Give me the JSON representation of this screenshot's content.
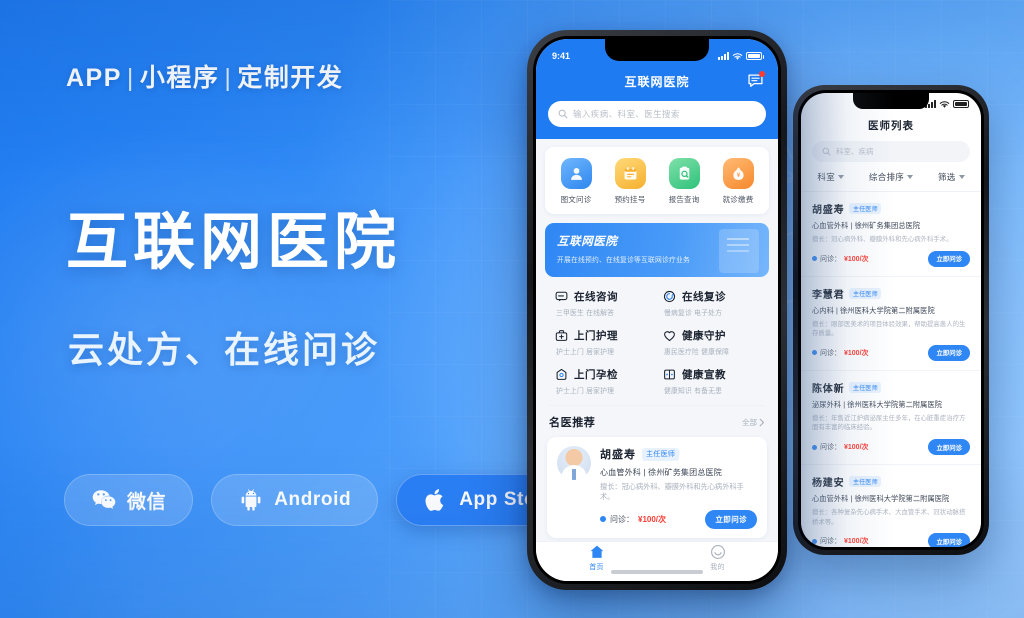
{
  "hero": {
    "kicker_parts": [
      "APP",
      "小程序",
      "定制开发"
    ],
    "kicker_separator": "|",
    "headline": "互联网医院",
    "subhead": "云处方、在线问诊"
  },
  "store_buttons": [
    {
      "label": "微信",
      "icon": "wechat-icon",
      "style": "ghost"
    },
    {
      "label": "Android",
      "icon": "android-icon",
      "style": "ghost"
    },
    {
      "label": "App Store",
      "icon": "apple-icon",
      "style": "solid"
    }
  ],
  "colors": {
    "brand_blue": "#2f86f5",
    "deep_blue": "#1f7bf2",
    "price_red": "#ff3a30",
    "tag_blue_bg": "#e8f2ff",
    "muted_text": "#a9b1bd"
  },
  "phone_front": {
    "status": {
      "time": "9:41",
      "signal_icon": "signal-bars-icon",
      "wifi_icon": "wifi-icon",
      "battery_icon": "battery-icon"
    },
    "nav": {
      "title": "互联网医院",
      "message_icon": "message-icon",
      "badge": ""
    },
    "search": {
      "placeholder": "输入疾病、科室、医生搜索",
      "icon": "search-icon"
    },
    "quick_actions": [
      {
        "label": "图文问诊",
        "icon": "doctor-avatar-icon",
        "color": "#2f86ee"
      },
      {
        "label": "预约挂号",
        "icon": "calendar-icon",
        "color": "#f5b02e"
      },
      {
        "label": "报告查询",
        "icon": "report-search-icon",
        "color": "#2ec27a"
      },
      {
        "label": "就诊缴费",
        "icon": "wallet-icon",
        "color": "#f6882c"
      }
    ],
    "banner": {
      "title": "互联网医院",
      "subtitle": "开展在线预约、在线复诊等互联网诊疗业务"
    },
    "services": [
      {
        "title": "在线咨询",
        "sub": "三甲医生 在线解答",
        "icon": "chat-bubble-icon"
      },
      {
        "title": "在线复诊",
        "sub": "慢病复诊 电子处方",
        "icon": "refresh-clock-icon"
      },
      {
        "title": "上门护理",
        "sub": "护士上门 居家护理",
        "icon": "medical-bag-icon"
      },
      {
        "title": "健康守护",
        "sub": "惠民医疗险 健康保障",
        "icon": "heart-shield-icon"
      },
      {
        "title": "上门孕检",
        "sub": "护士上门 居家护理",
        "icon": "pregnancy-test-icon"
      },
      {
        "title": "健康宣教",
        "sub": "健康知识 有备无患",
        "icon": "open-book-icon"
      }
    ],
    "section": {
      "title": "名医推荐",
      "more": "全部",
      "more_icon": "chevron-right-icon"
    },
    "featured_doctor": {
      "name": "胡盛寿",
      "tag": "主任医师",
      "dept_hospital": "心血管外科 | 徐州矿务集团总医院",
      "specialty": "擅长：冠心病外科、瓣膜外科和先心病外科手术。",
      "price_label": "问诊：",
      "price": "¥100/次",
      "button": "立即问诊",
      "avatar_icon": "doctor-avatar"
    },
    "tabbar": [
      {
        "label": "首页",
        "icon": "home-icon",
        "active": true
      },
      {
        "label": "我的",
        "icon": "user-circle-icon",
        "active": false
      }
    ]
  },
  "phone_back": {
    "status": {
      "signal_icon": "signal-bars-icon",
      "wifi_icon": "wifi-icon",
      "battery_icon": "battery-icon"
    },
    "title": "医师列表",
    "search": {
      "placeholder": "科室、疾病",
      "icon": "search-icon"
    },
    "filters": [
      {
        "label": "科室",
        "icon": "chevron-down-icon"
      },
      {
        "label": "综合排序",
        "icon": "chevron-down-icon"
      },
      {
        "label": "筛选",
        "icon": "chevron-down-icon"
      }
    ],
    "doctors": [
      {
        "name": "胡盛寿",
        "tag": "主任医师",
        "dept_hospital": "心血管外科 | 徐州矿务集团总医院",
        "specialty": "擅长：冠心病外科、瓣膜外科和先心病外科手术。",
        "price_label": "问诊：",
        "price": "¥100/次",
        "button": "立即问诊"
      },
      {
        "name": "李慧君",
        "tag": "主任医师",
        "dept_hospital": "心内科 | 徐州医科大学院第二附属医院",
        "specialty": "擅长：眼部医美术的项目体验效果，帮助提高患人的生存质量。",
        "price_label": "问诊：",
        "price": "¥100/次",
        "button": "立即问诊"
      },
      {
        "name": "陈体新",
        "tag": "主任医师",
        "dept_hospital": "泌尿外科 | 徐州医科大学院第二附属医院",
        "specialty": "擅长：年售近江护病泌尿主任多年，在心脏重症治疗方面有丰富的临床经验。",
        "price_label": "问诊：",
        "price": "¥100/次",
        "button": "立即问诊"
      },
      {
        "name": "杨建安",
        "tag": "主任医师",
        "dept_hospital": "心血管外科 | 徐州医科大学院第二附属医院",
        "specialty": "擅长：各种复杂先心病手术、大血管手术、冠状动脉搭桥术等。",
        "price_label": "问诊：",
        "price": "¥100/次",
        "button": "立即问诊"
      }
    ]
  }
}
